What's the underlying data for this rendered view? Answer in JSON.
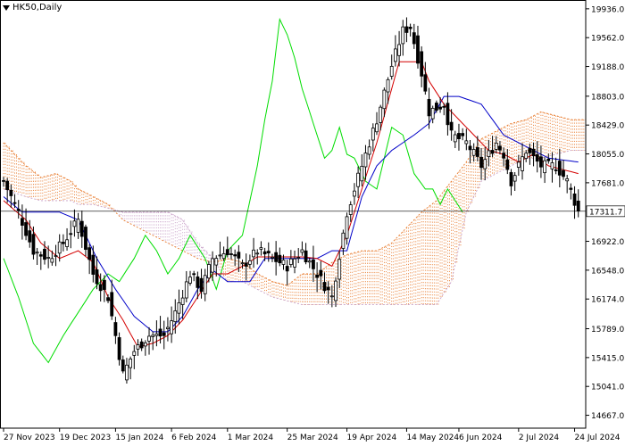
{
  "symbol_label": "HK50,Daily",
  "chart_data": {
    "type": "candlestick",
    "title": "HK50,Daily",
    "current_price": 17311.7,
    "colors": {
      "candle_up": "#000000",
      "candle_down": "#000000",
      "tenkan_sen": "#d40000",
      "kijun_sen": "#0000c8",
      "chikou_span": "#00dd00",
      "kumo_bullish": "#e87a2c",
      "kumo_bearish": "#c8a0c8",
      "price_line": "#000000"
    },
    "y_axis": {
      "range": [
        14500,
        20050
      ],
      "ticks": [
        {
          "value": 19936,
          "label": "19936.0"
        },
        {
          "value": 19562,
          "label": "19562.0"
        },
        {
          "value": 19188,
          "label": "19188.0"
        },
        {
          "value": 18803,
          "label": "18803.0"
        },
        {
          "value": 18429,
          "label": "18429.0"
        },
        {
          "value": 18055,
          "label": "18055.0"
        },
        {
          "value": 17681,
          "label": "17681.0"
        },
        {
          "value": 16922,
          "label": "16922.0"
        },
        {
          "value": 16548,
          "label": "16548.0"
        },
        {
          "value": 16174,
          "label": "16174.0"
        },
        {
          "value": 15789,
          "label": "15789.0"
        },
        {
          "value": 15415,
          "label": "15415.0"
        },
        {
          "value": 15041,
          "label": "15041.0"
        },
        {
          "value": 14667,
          "label": "14667.0"
        }
      ]
    },
    "x_axis": {
      "labels": [
        {
          "index": 0,
          "label": "27 Nov 2023"
        },
        {
          "index": 15,
          "label": "19 Dec 2023"
        },
        {
          "index": 30,
          "label": "15 Jan 2024"
        },
        {
          "index": 45,
          "label": "6 Feb 2024"
        },
        {
          "index": 60,
          "label": "1 Mar 2024"
        },
        {
          "index": 76,
          "label": "25 Mar 2024"
        },
        {
          "index": 92,
          "label": "19 Apr 2024"
        },
        {
          "index": 108,
          "label": "14 May 2024"
        },
        {
          "index": 122,
          "label": "6 Jun 2024"
        },
        {
          "index": 138,
          "label": "2 Jul 2024"
        },
        {
          "index": 153,
          "label": "24 Jul 2024"
        }
      ]
    },
    "close_anchors": [
      [
        0,
        17700
      ],
      [
        4,
        17300
      ],
      [
        8,
        16800
      ],
      [
        12,
        16700
      ],
      [
        16,
        16900
      ],
      [
        20,
        17200
      ],
      [
        24,
        16500
      ],
      [
        28,
        16200
      ],
      [
        32,
        15200
      ],
      [
        35,
        15500
      ],
      [
        39,
        15700
      ],
      [
        43,
        15700
      ],
      [
        46,
        16000
      ],
      [
        50,
        16500
      ],
      [
        53,
        16300
      ],
      [
        56,
        16700
      ],
      [
        60,
        16800
      ],
      [
        64,
        16600
      ],
      [
        68,
        16800
      ],
      [
        72,
        16700
      ],
      [
        76,
        16600
      ],
      [
        80,
        16800
      ],
      [
        84,
        16500
      ],
      [
        88,
        16200
      ],
      [
        92,
        17300
      ],
      [
        96,
        17900
      ],
      [
        100,
        18500
      ],
      [
        104,
        19200
      ],
      [
        107,
        19650
      ],
      [
        109,
        19700
      ],
      [
        112,
        19100
      ],
      [
        114,
        18600
      ],
      [
        118,
        18700
      ],
      [
        120,
        18300
      ],
      [
        124,
        18200
      ],
      [
        128,
        17900
      ],
      [
        132,
        18200
      ],
      [
        134,
        18050
      ],
      [
        136,
        17700
      ],
      [
        140,
        18100
      ],
      [
        144,
        17900
      ],
      [
        148,
        17900
      ],
      [
        151,
        17700
      ],
      [
        154,
        17312
      ]
    ],
    "tenkan_sen": [
      [
        0,
        17450
      ],
      [
        6,
        17200
      ],
      [
        10,
        16900
      ],
      [
        15,
        16700
      ],
      [
        20,
        16800
      ],
      [
        24,
        16650
      ],
      [
        28,
        16200
      ],
      [
        32,
        15900
      ],
      [
        36,
        15550
      ],
      [
        40,
        15600
      ],
      [
        44,
        15700
      ],
      [
        48,
        15900
      ],
      [
        52,
        16200
      ],
      [
        56,
        16500
      ],
      [
        60,
        16500
      ],
      [
        64,
        16600
      ],
      [
        68,
        16720
      ],
      [
        72,
        16720
      ],
      [
        76,
        16720
      ],
      [
        80,
        16720
      ],
      [
        84,
        16700
      ],
      [
        88,
        16600
      ],
      [
        92,
        17000
      ],
      [
        96,
        17600
      ],
      [
        100,
        18200
      ],
      [
        104,
        18900
      ],
      [
        106,
        19250
      ],
      [
        112,
        19250
      ],
      [
        114,
        19000
      ],
      [
        118,
        18700
      ],
      [
        122,
        18500
      ],
      [
        126,
        18300
      ],
      [
        130,
        18100
      ],
      [
        134,
        18050
      ],
      [
        138,
        17950
      ],
      [
        142,
        18050
      ],
      [
        146,
        17900
      ],
      [
        150,
        17850
      ],
      [
        154,
        17800
      ]
    ],
    "kijun_sen": [
      [
        0,
        17500
      ],
      [
        5,
        17300
      ],
      [
        10,
        17300
      ],
      [
        15,
        17300
      ],
      [
        20,
        17200
      ],
      [
        25,
        16700
      ],
      [
        30,
        16300
      ],
      [
        35,
        15950
      ],
      [
        40,
        15750
      ],
      [
        44,
        15750
      ],
      [
        48,
        15950
      ],
      [
        52,
        16300
      ],
      [
        56,
        16550
      ],
      [
        60,
        16400
      ],
      [
        66,
        16400
      ],
      [
        70,
        16700
      ],
      [
        76,
        16700
      ],
      [
        84,
        16700
      ],
      [
        88,
        16800
      ],
      [
        92,
        16800
      ],
      [
        96,
        17500
      ],
      [
        100,
        17900
      ],
      [
        104,
        18100
      ],
      [
        110,
        18300
      ],
      [
        114,
        18450
      ],
      [
        118,
        18800
      ],
      [
        122,
        18800
      ],
      [
        128,
        18700
      ],
      [
        134,
        18300
      ],
      [
        140,
        18150
      ],
      [
        146,
        18000
      ],
      [
        154,
        17950
      ]
    ],
    "chikou_span": [
      [
        0,
        16700
      ],
      [
        4,
        16200
      ],
      [
        8,
        15600
      ],
      [
        12,
        15350
      ],
      [
        16,
        15700
      ],
      [
        20,
        16000
      ],
      [
        24,
        16300
      ],
      [
        28,
        16500
      ],
      [
        31,
        16400
      ],
      [
        35,
        16700
      ],
      [
        38,
        17000
      ],
      [
        41,
        16800
      ],
      [
        44,
        16500
      ],
      [
        47,
        16700
      ],
      [
        50,
        17000
      ],
      [
        54,
        16700
      ],
      [
        57,
        16300
      ],
      [
        60,
        16800
      ],
      [
        64,
        17000
      ],
      [
        68,
        17900
      ],
      [
        70,
        18500
      ],
      [
        72,
        19000
      ],
      [
        74,
        19800
      ],
      [
        76,
        19600
      ],
      [
        78,
        19300
      ],
      [
        80,
        18900
      ],
      [
        82,
        18600
      ],
      [
        84,
        18300
      ],
      [
        86,
        18000
      ],
      [
        88,
        18100
      ],
      [
        90,
        18400
      ],
      [
        92,
        18050
      ],
      [
        94,
        18000
      ],
      [
        97,
        17700
      ],
      [
        100,
        17600
      ],
      [
        104,
        18400
      ],
      [
        107,
        18300
      ],
      [
        110,
        17800
      ],
      [
        113,
        17600
      ],
      [
        115,
        17600
      ],
      [
        117,
        17400
      ],
      [
        119,
        17600
      ],
      [
        123,
        17300
      ]
    ],
    "kumo_span_a": [
      [
        0,
        18200
      ],
      [
        6,
        17900
      ],
      [
        10,
        17750
      ],
      [
        14,
        17800
      ],
      [
        18,
        17700
      ],
      [
        20,
        17600
      ],
      [
        24,
        17500
      ],
      [
        28,
        17400
      ],
      [
        32,
        17200
      ],
      [
        36,
        17100
      ],
      [
        40,
        17000
      ],
      [
        44,
        16900
      ],
      [
        48,
        16800
      ],
      [
        52,
        16700
      ],
      [
        56,
        16650
      ],
      [
        60,
        16700
      ],
      [
        64,
        16650
      ],
      [
        68,
        16500
      ],
      [
        72,
        16400
      ],
      [
        76,
        16350
      ],
      [
        80,
        16500
      ],
      [
        84,
        16500
      ],
      [
        88,
        16650
      ],
      [
        92,
        16750
      ],
      [
        96,
        16800
      ],
      [
        100,
        16800
      ],
      [
        104,
        16900
      ],
      [
        108,
        17100
      ],
      [
        112,
        17300
      ],
      [
        116,
        17450
      ],
      [
        120,
        17700
      ],
      [
        124,
        17950
      ],
      [
        128,
        18250
      ],
      [
        132,
        18350
      ],
      [
        136,
        18450
      ],
      [
        140,
        18500
      ],
      [
        144,
        18600
      ],
      [
        148,
        18550
      ],
      [
        152,
        18500
      ],
      [
        156,
        18500
      ]
    ],
    "kumo_span_b": [
      [
        0,
        17600
      ],
      [
        6,
        17500
      ],
      [
        10,
        17450
      ],
      [
        14,
        17450
      ],
      [
        18,
        17450
      ],
      [
        20,
        17400
      ],
      [
        24,
        17400
      ],
      [
        28,
        17350
      ],
      [
        32,
        17300
      ],
      [
        36,
        17300
      ],
      [
        40,
        17300
      ],
      [
        44,
        17300
      ],
      [
        48,
        17200
      ],
      [
        52,
        16900
      ],
      [
        56,
        16700
      ],
      [
        60,
        16400
      ],
      [
        64,
        16400
      ],
      [
        68,
        16300
      ],
      [
        72,
        16200
      ],
      [
        76,
        16150
      ],
      [
        80,
        16100
      ],
      [
        84,
        16100
      ],
      [
        88,
        16100
      ],
      [
        92,
        16100
      ],
      [
        96,
        16100
      ],
      [
        100,
        16100
      ],
      [
        104,
        16100
      ],
      [
        108,
        16100
      ],
      [
        112,
        16100
      ],
      [
        116,
        16100
      ],
      [
        120,
        16400
      ],
      [
        124,
        17300
      ],
      [
        128,
        17700
      ],
      [
        132,
        17800
      ],
      [
        136,
        17900
      ],
      [
        140,
        18000
      ],
      [
        144,
        18000
      ],
      [
        148,
        18050
      ],
      [
        152,
        18100
      ],
      [
        156,
        18100
      ]
    ]
  }
}
